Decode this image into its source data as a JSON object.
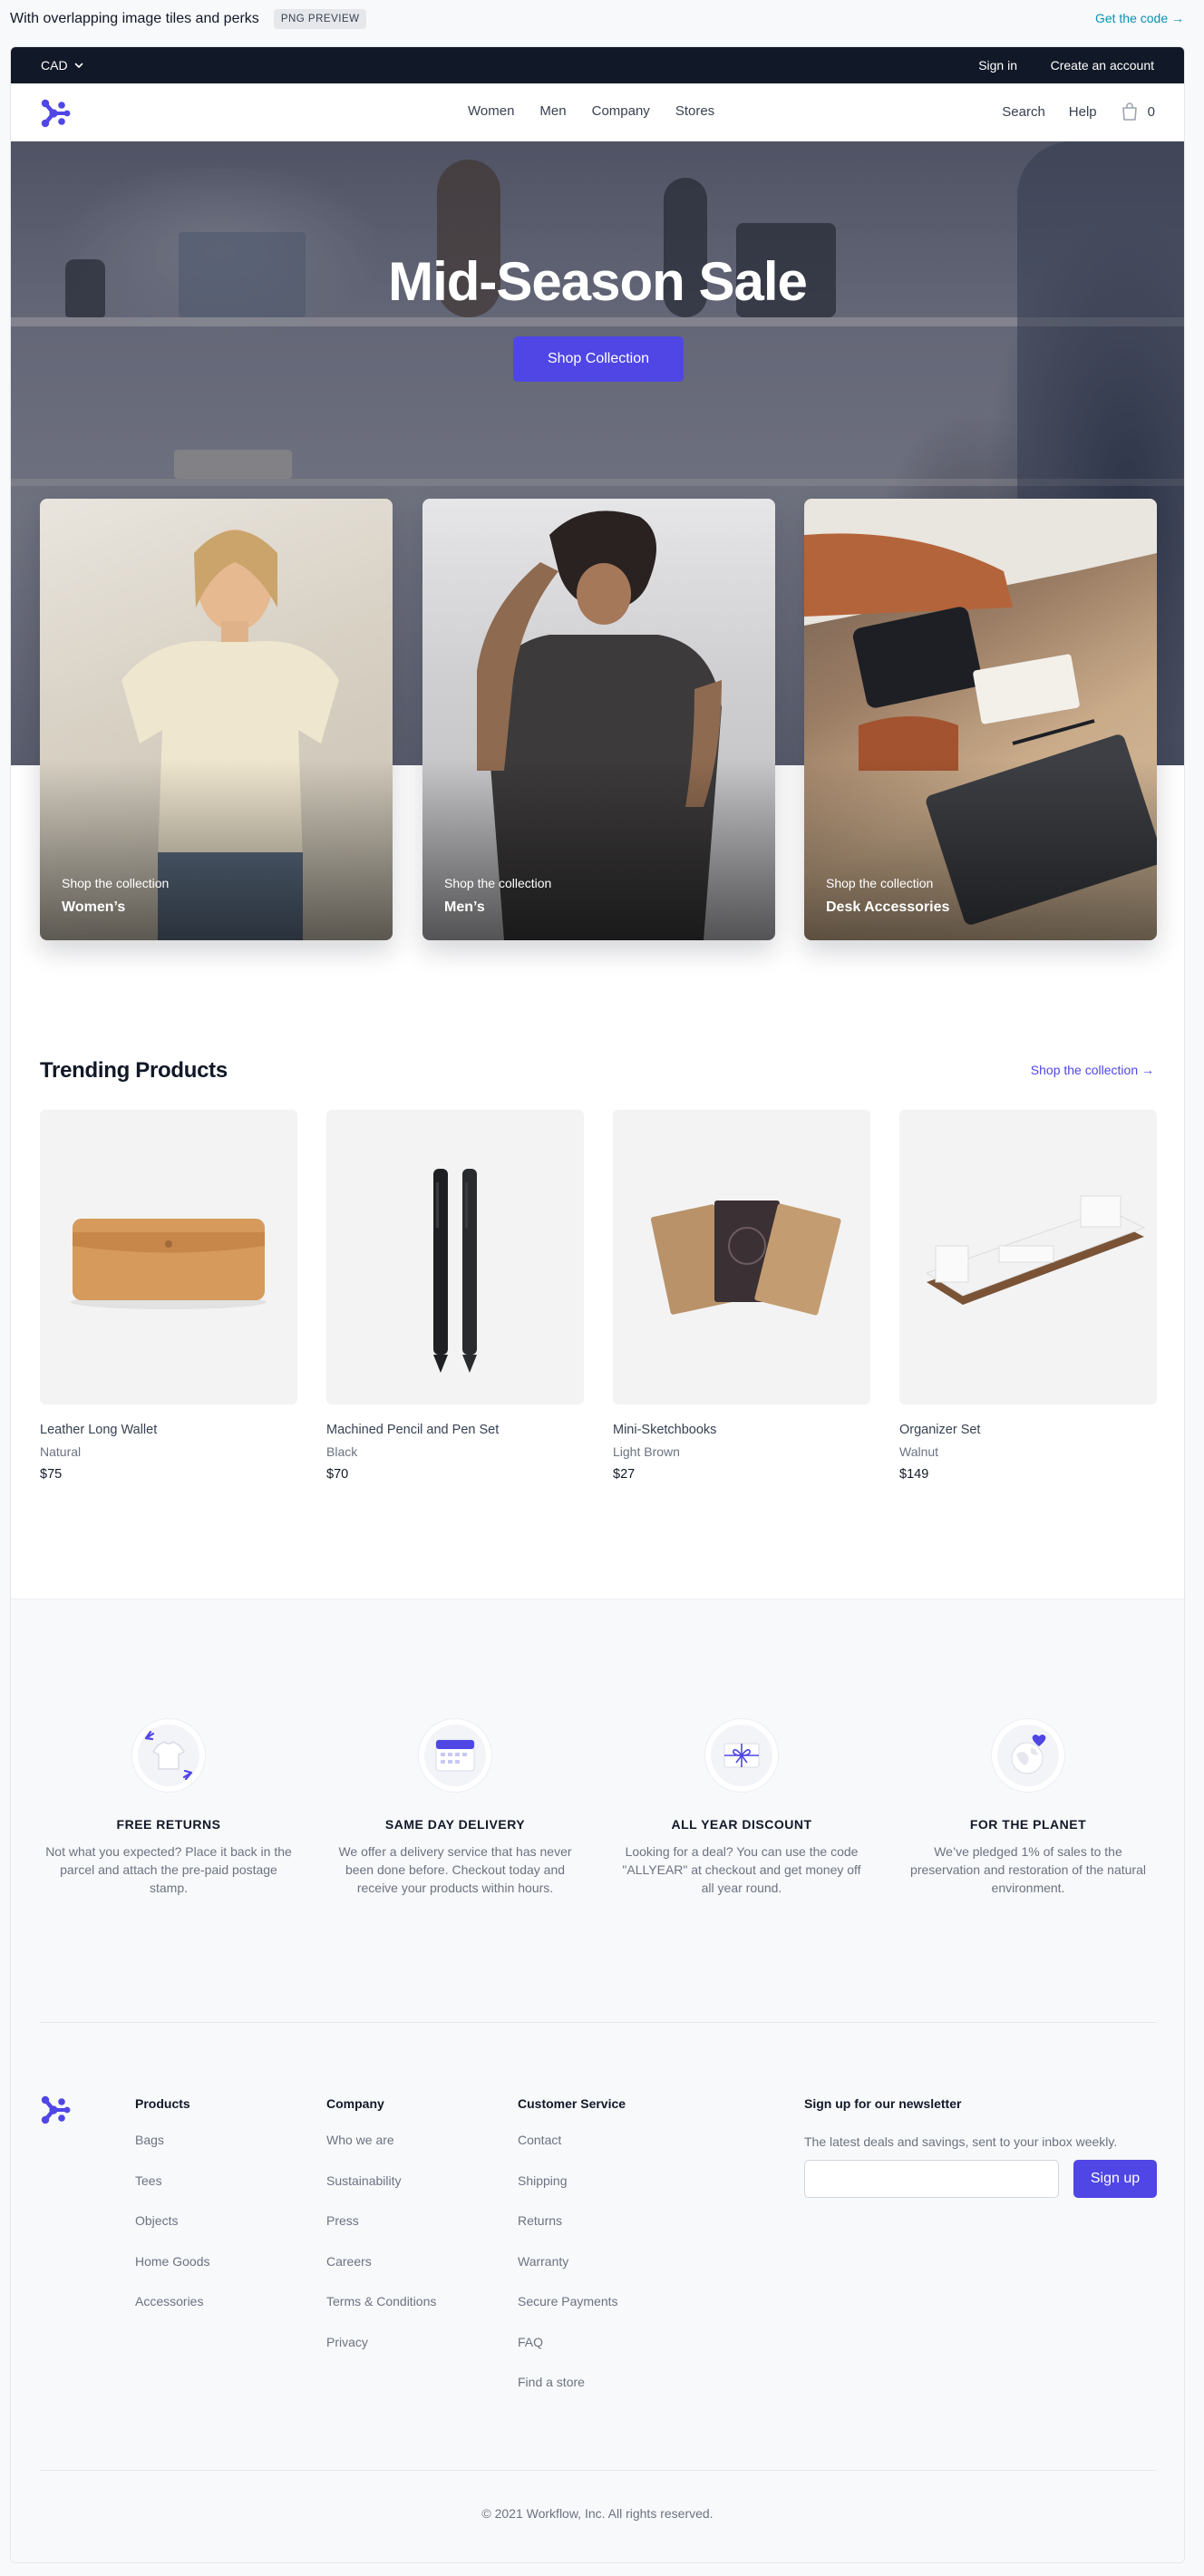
{
  "preview": {
    "title": "With overlapping image tiles and perks",
    "badge": "PNG PREVIEW",
    "get_code": "Get the code →"
  },
  "topbar": {
    "currency": "CAD",
    "sign_in": "Sign in",
    "create_account": "Create an account"
  },
  "nav": {
    "links": [
      "Women",
      "Men",
      "Company",
      "Stores"
    ],
    "search": "Search",
    "help": "Help",
    "cart_count": "0"
  },
  "hero": {
    "title": "Mid-Season Sale",
    "cta": "Shop Collection"
  },
  "categories": [
    {
      "subtitle": "Shop the collection",
      "name": "Women’s"
    },
    {
      "subtitle": "Shop the collection",
      "name": "Men’s"
    },
    {
      "subtitle": "Shop the collection",
      "name": "Desk Accessories"
    }
  ],
  "trending": {
    "title": "Trending Products",
    "link": "Shop the collection →",
    "products": [
      {
        "name": "Leather Long Wallet",
        "color": "Natural",
        "price": "$75"
      },
      {
        "name": "Machined Pencil and Pen Set",
        "color": "Black",
        "price": "$70"
      },
      {
        "name": "Mini-Sketchbooks",
        "color": "Light Brown",
        "price": "$27"
      },
      {
        "name": "Organizer Set",
        "color": "Walnut",
        "price": "$149"
      }
    ]
  },
  "perks": [
    {
      "title": "FREE RETURNS",
      "description": "Not what you expected? Place it back in the parcel and attach the pre-paid postage stamp.",
      "icon": "returns-tshirt-icon"
    },
    {
      "title": "SAME DAY DELIVERY",
      "description": "We offer a delivery service that has never been done before. Checkout today and receive your products within hours.",
      "icon": "calendar-icon"
    },
    {
      "title": "ALL YEAR DISCOUNT",
      "description": "Looking for a deal? You can use the code \"ALLYEAR\" at checkout and get money off all year round.",
      "icon": "gift-card-icon"
    },
    {
      "title": "FOR THE PLANET",
      "description": "We’ve pledged 1% of sales to the preservation and restoration of the natural environment.",
      "icon": "planet-heart-icon"
    }
  ],
  "footer": {
    "products": {
      "heading": "Products",
      "items": [
        "Bags",
        "Tees",
        "Objects",
        "Home Goods",
        "Accessories"
      ]
    },
    "company": {
      "heading": "Company",
      "items": [
        "Who we are",
        "Sustainability",
        "Press",
        "Careers",
        "Terms & Conditions",
        "Privacy"
      ]
    },
    "customer_service": {
      "heading": "Customer Service",
      "items": [
        "Contact",
        "Shipping",
        "Returns",
        "Warranty",
        "Secure Payments",
        "FAQ",
        "Find a store"
      ]
    },
    "newsletter": {
      "heading": "Sign up for our newsletter",
      "text": "The latest deals and savings, sent to your inbox weekly.",
      "placeholder": "",
      "button": "Sign up"
    },
    "copyright": "© 2021 Workflow, Inc. All rights reserved."
  },
  "colors": {
    "accent": "#4f46e5",
    "topbar": "#111827",
    "link_cyan": "#0891b2"
  }
}
